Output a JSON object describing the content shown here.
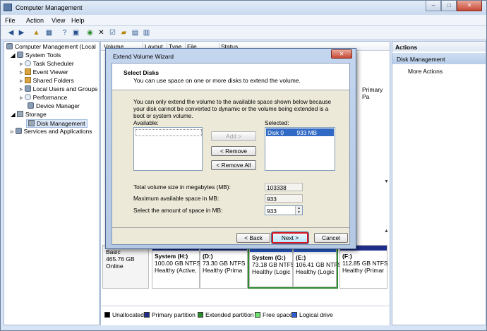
{
  "window": {
    "title": "Computer Management",
    "controls": {
      "minimize": "–",
      "maximize": "□",
      "close": "✕"
    }
  },
  "menu": {
    "items": [
      "File",
      "Action",
      "View",
      "Help"
    ]
  },
  "tree": {
    "root": "Computer Management (Local",
    "system_tools": "System Tools",
    "task_scheduler": "Task Scheduler",
    "event_viewer": "Event Viewer",
    "shared_folders": "Shared Folders",
    "local_users": "Local Users and Groups",
    "performance": "Performance",
    "device_manager": "Device Manager",
    "storage": "Storage",
    "disk_management": "Disk Management",
    "services": "Services and Applications"
  },
  "center": {
    "columns": [
      "Volume",
      "Layout",
      "Type",
      "File System",
      "Status"
    ],
    "partial_text": "Primary Pa",
    "disk": {
      "type": "Basic",
      "size": "465.76 GB",
      "state": "Online"
    },
    "partitions": [
      {
        "name": "System (H:)",
        "size": "100.00 GB NTFS",
        "status": "Healthy (Active,",
        "bar_color": "#1f2d8a"
      },
      {
        "name": "(D:)",
        "size": "73.30 GB NTFS",
        "status": "Healthy (Prima",
        "bar_color": "#1f2d8a"
      },
      {
        "name": "System (G:)",
        "size": "73.18 GB NTFS",
        "status": "Healthy (Logic",
        "bar_color": "#1f2d8a"
      },
      {
        "name": "(E:)",
        "size": "106.41 GB NTFS",
        "status": "Healthy (Logic",
        "bar_color": "#1f2d8a"
      },
      {
        "name": "(F:)",
        "size": "112.85 GB NTFS",
        "status": "Healthy (Primar",
        "bar_color": "#1f2d8a"
      }
    ],
    "legend": [
      {
        "label": "Unallocated",
        "color": "#000000"
      },
      {
        "label": "Primary partition",
        "color": "#1f2d8a"
      },
      {
        "label": "Extended partition",
        "color": "#2d8a2d"
      },
      {
        "label": "Free space",
        "color": "#6ee36e"
      },
      {
        "label": "Logical drive",
        "color": "#2c5fd6"
      }
    ]
  },
  "actions": {
    "header": "Actions",
    "section": "Disk Management",
    "more": "More Actions"
  },
  "dialog": {
    "title": "Extend Volume Wizard",
    "close": "✕",
    "heading": "Select Disks",
    "subheading": "You can use space on one or more disks to extend the volume.",
    "info": "You can only extend the volume to the available space shown below because your disk cannot be converted to dynamic or the volume being extended is a boot or system volume.",
    "available_label": "Available:",
    "selected_label": "Selected:",
    "selected_item": "Disk 0        933 MB",
    "add_button": "Add >",
    "remove_button": "< Remove",
    "remove_all_button": "< Remove All",
    "total_label": "Total volume size in megabytes (MB):",
    "total_value": "103338",
    "max_label": "Maximum available space in MB:",
    "max_value": "933",
    "amount_label": "Select the amount of space in MB:",
    "amount_value": "933",
    "back_button": "< Back",
    "next_button": "Next >",
    "cancel_button": "Cancel"
  }
}
